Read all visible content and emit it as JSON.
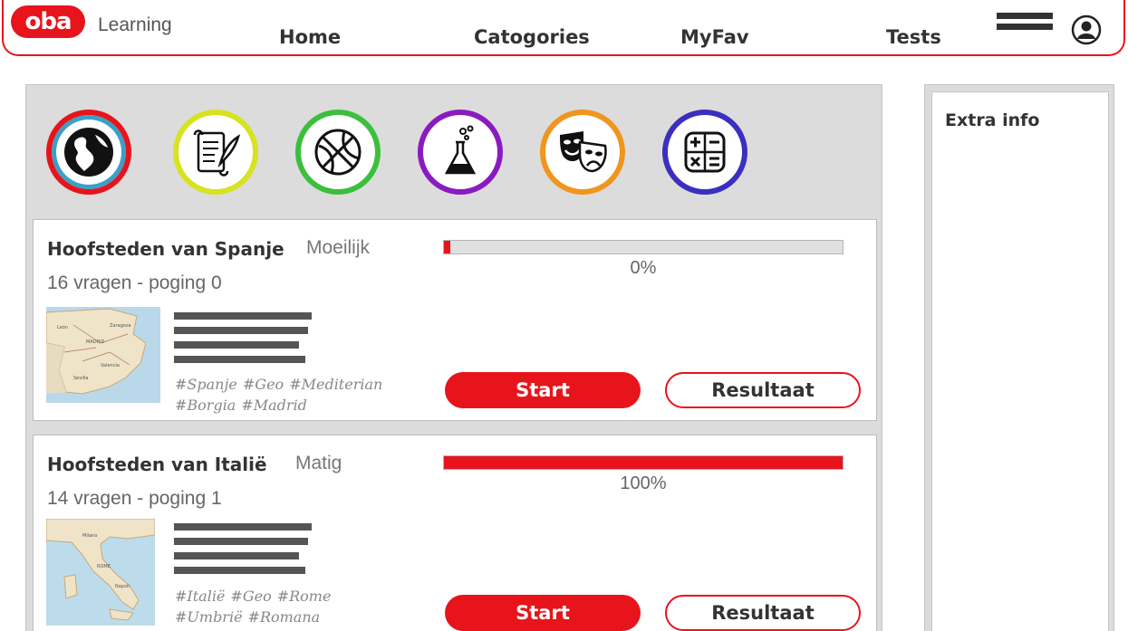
{
  "header": {
    "logo_text": "oba",
    "app_name": "Learning",
    "nav": [
      "Home",
      "Catogories",
      "MyFav",
      "Tests"
    ],
    "menu_icon": "hamburger-menu-icon",
    "user_icon": "user-account-icon",
    "brand_color": "#e8141b"
  },
  "categories": [
    {
      "name": "globe-icon",
      "color": "#e8141b",
      "inner_color": "#3aa0c8",
      "selected": true
    },
    {
      "name": "scroll-quill-icon",
      "color": "#d8e21e"
    },
    {
      "name": "basketball-icon",
      "color": "#3cbf3c"
    },
    {
      "name": "flask-icon",
      "color": "#8a1bc0"
    },
    {
      "name": "theatre-masks-icon",
      "color": "#f0961e"
    },
    {
      "name": "calculator-icon",
      "color": "#3a2fbf"
    }
  ],
  "quizzes": [
    {
      "title": "Hoofsteden van Spanje",
      "difficulty": "Moeilijk",
      "subtitle": "16 vragen - poging 0",
      "progress": 0.015,
      "progress_label": "0%",
      "tags_line1": [
        "#Spanje",
        "#Geo",
        "#Mediterian"
      ],
      "tags_line2": [
        "#Borgia",
        "#Madrid"
      ],
      "start_label": "Start",
      "result_label": "Resultaat"
    },
    {
      "title": "Hoofsteden van Italië",
      "difficulty": "Matig",
      "subtitle": "14 vragen - poging 1",
      "progress": 1.0,
      "progress_label": "100%",
      "tags_line1": [
        "#Italië",
        "#Geo",
        "#Rome"
      ],
      "tags_line2": [
        "#Umbrië",
        "#Romana"
      ],
      "start_label": "Start",
      "result_label": "Resultaat"
    }
  ],
  "side": {
    "title": "Extra info"
  }
}
